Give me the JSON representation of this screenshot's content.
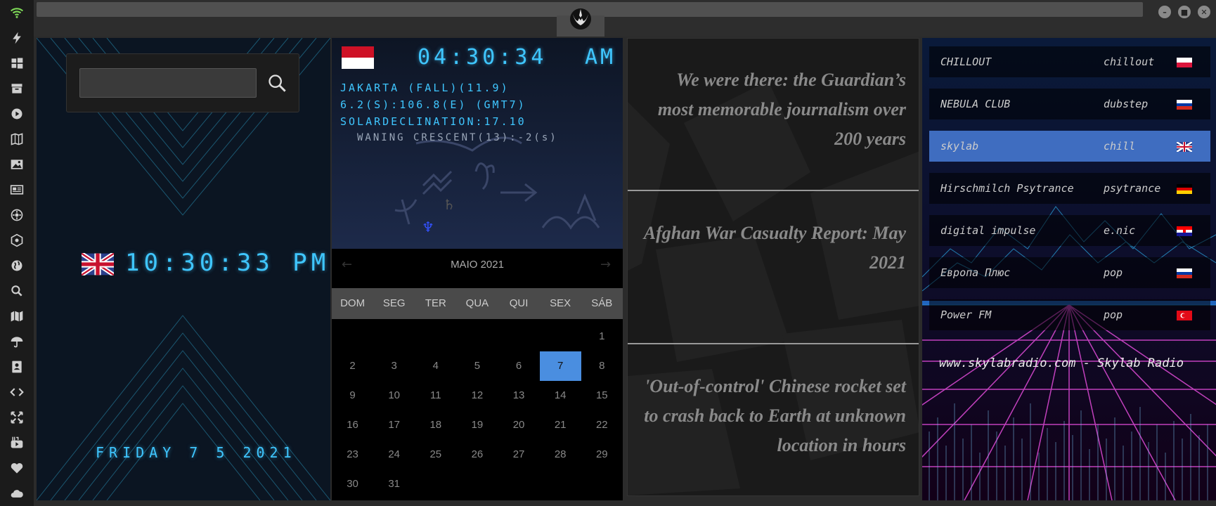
{
  "window": {
    "logo": "rebel-alliance-logo",
    "buttons": [
      "minimize",
      "maximize",
      "close"
    ]
  },
  "sidebar": {
    "icons": [
      "wifi-icon",
      "bolt-icon",
      "windows-icon",
      "archive-icon",
      "play-icon",
      "map-book-icon",
      "image-icon",
      "news-icon",
      "sun-icon",
      "network-icon",
      "globe-icon",
      "search-icon",
      "map-icon",
      "umbrella-icon",
      "contacts-icon",
      "code-icon",
      "expand-icon",
      "youtube-icon",
      "heart-icon",
      "cloud-icon"
    ]
  },
  "search": {
    "placeholder": "",
    "value": ""
  },
  "clock": {
    "time": "10:30:33 PM",
    "date": "FRIDAY 7 5 2021",
    "accent": "#3fc6ff"
  },
  "astro": {
    "time": "04:30:34",
    "meridiem": "AM",
    "line1": "JAKARTA (FALL)(11.9)",
    "line2": "6.2(S):106.8(E) (GMT7)",
    "line3": "SOLARDECLINATION:17.10",
    "line4": "WANING CRESCENT(13):-2(s)"
  },
  "calendar": {
    "month": "MAIO 2021",
    "prev": "←",
    "next": "→",
    "weekdays": [
      "DOM",
      "SEG",
      "TER",
      "QUA",
      "QUI",
      "SEX",
      "SÁB"
    ],
    "weeks": [
      [
        "",
        "",
        "",
        "",
        "",
        "",
        "1"
      ],
      [
        "2",
        "3",
        "4",
        "5",
        "6",
        "7",
        "8"
      ],
      [
        "9",
        "10",
        "11",
        "12",
        "13",
        "14",
        "15"
      ],
      [
        "16",
        "17",
        "18",
        "19",
        "20",
        "21",
        "22"
      ],
      [
        "23",
        "24",
        "25",
        "26",
        "27",
        "28",
        "29"
      ],
      [
        "30",
        "31",
        "",
        "",
        "",
        "",
        ""
      ]
    ],
    "today": "7",
    "today_color": "#4a8ee0"
  },
  "news": [
    {
      "title": "We were there: the Guardian’s most memorable journalism over 200 years"
    },
    {
      "title": "Afghan War Casualty Report: May 2021"
    },
    {
      "title": "'Out-of-control' Chinese rocket set to crash back to Earth at unknown location in hours"
    }
  ],
  "radio": {
    "stations": [
      {
        "name": "CHILLOUT",
        "genre": "chillout",
        "flag": "flag-poland",
        "active": false
      },
      {
        "name": "NEBULA CLUB",
        "genre": "dubstep",
        "flag": "flag-russia",
        "active": false
      },
      {
        "name": "skylab",
        "genre": "chill",
        "flag": "flag-uk",
        "active": true
      },
      {
        "name": "Hirschmilch Psytrance",
        "genre": "psytrance",
        "flag": "flag-germany",
        "active": false
      },
      {
        "name": "digital impulse",
        "genre": "e.nic",
        "flag": "flag-croatia",
        "active": false
      },
      {
        "name": "Европа Плюс",
        "genre": "pop",
        "flag": "flag-russia",
        "active": false
      },
      {
        "name": "Power FM",
        "genre": "pop",
        "flag": "flag-turkey",
        "active": false
      }
    ],
    "now_playing": "www.skylabradio.com - Skylab Radio",
    "active_color": "#3f6dc0"
  }
}
